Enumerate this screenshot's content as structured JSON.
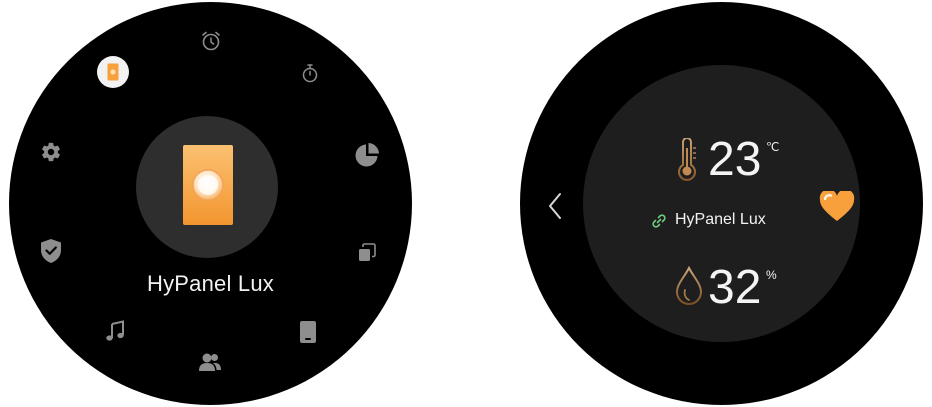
{
  "left_screen": {
    "device_name": "HyPanel Lux",
    "icons": [
      "alarm-clock-icon",
      "timer-icon",
      "pie-chart-icon",
      "copy-icon",
      "tablet-icon",
      "contacts-icon",
      "music-note-icon",
      "shield-check-icon",
      "gear-icon",
      "panel-device-icon"
    ]
  },
  "right_screen": {
    "temperature": {
      "value": "23",
      "unit": "℃",
      "icon": "thermometer-icon"
    },
    "humidity": {
      "value": "32",
      "unit": "%",
      "icon": "water-drop-icon"
    },
    "device_name": "HyPanel Lux",
    "link_icon": "link-icon",
    "back_icon": "chevron-left-icon",
    "favorite_icon": "heart-icon"
  },
  "colors": {
    "background": "#000000",
    "accent_orange": "#f7a03c",
    "link_green": "#6fce7e",
    "text": "#f2f2f2",
    "icon_gray": "#9a9a9a"
  }
}
